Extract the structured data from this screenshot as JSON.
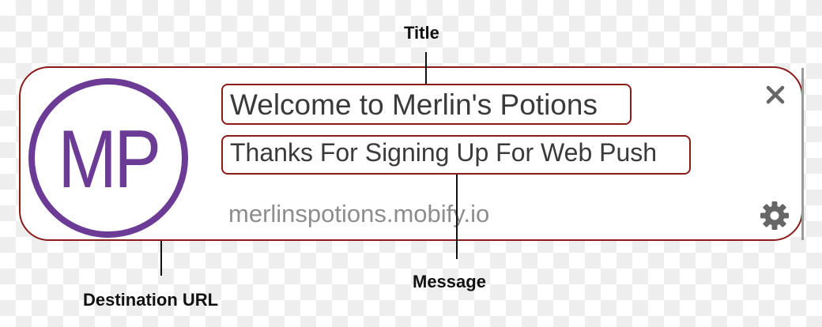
{
  "notification": {
    "avatar_initials": "MP",
    "title": "Welcome to Merlin's Potions",
    "message": "Thanks For Signing Up For Web Push",
    "destination_url": "merlinspotions.mobify.io",
    "close_icon": "close-icon",
    "settings_icon": "gear-icon"
  },
  "callouts": {
    "title": "Title",
    "message": "Message",
    "destination_url": "Destination URL"
  },
  "colors": {
    "brand_purple": "#6c3b96",
    "outline": "#8b1a1a",
    "title_text": "#3a3a3a",
    "url_text": "#8d8d8d",
    "icon_gray": "#666666"
  }
}
